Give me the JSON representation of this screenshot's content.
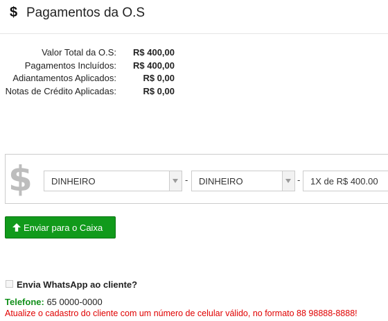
{
  "header": {
    "icon": "dollar-icon",
    "icon_glyph": "$",
    "title": "Pagamentos da O.S"
  },
  "summary": [
    {
      "label": "Valor Total da O.S:",
      "value": "R$ 400,00"
    },
    {
      "label": "Pagamentos Incluídos:",
      "value": "R$ 400,00"
    },
    {
      "label": "Adiantamentos Aplicados:",
      "value": "R$ 0,00"
    },
    {
      "label": "Notas de Crédito Aplicadas:",
      "value": "R$ 0,00"
    }
  ],
  "payment": {
    "icon": "dollar-icon",
    "icon_glyph": "$",
    "method_select": "DINHEIRO",
    "submethod_select": "DINHEIRO",
    "separator": "-",
    "installments_select": "1X de R$ 400.00"
  },
  "send_button": {
    "icon": "arrow-up-icon",
    "label": "Enviar para o Caixa",
    "color": "#119a1b"
  },
  "whatsapp": {
    "checked": false,
    "label": "Envia WhatsApp ao cliente?"
  },
  "phone": {
    "label": "Telefone:",
    "value": "65 0000-0000"
  },
  "warning": "Atualize o cadastro do cliente com um número de celular válido, no formato 88 98888-8888!"
}
